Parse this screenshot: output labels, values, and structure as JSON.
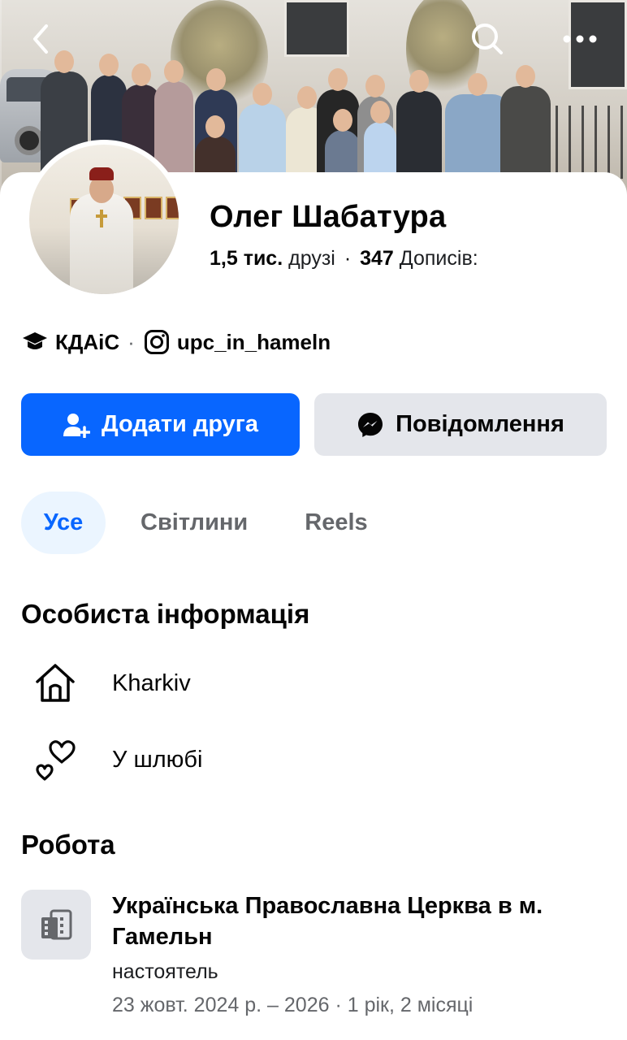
{
  "header": {
    "back_icon": "chevron-left-icon",
    "search_icon": "search-icon",
    "more_icon": "more-horizontal-icon"
  },
  "profile": {
    "name": "Олег Шабатура",
    "friends_count": "1,5 тис.",
    "friends_label": "друзі",
    "separator": "·",
    "posts_count": "347",
    "posts_label": "Дописів:"
  },
  "meta": {
    "education": "КДАіС",
    "instagram": "upc_in_hameln",
    "dot": "·"
  },
  "actions": {
    "add_friend_label": "Додати друга",
    "message_label": "Повідомлення"
  },
  "tabs": [
    {
      "label": "Усе",
      "active": true
    },
    {
      "label": "Світлини",
      "active": false
    },
    {
      "label": "Reels",
      "active": false
    }
  ],
  "personal_info": {
    "title": "Особиста інформація",
    "city": "Kharkiv",
    "relationship": "У шлюбі"
  },
  "work": {
    "title": "Робота",
    "employer": "Українська Православна Церква в м. Гамельн",
    "position": "настоятель",
    "dates": "23 жовт. 2024 р. – 2026 · 1 рік, 2 місяці"
  },
  "colors": {
    "primary": "#0866ff",
    "secondary_button": "#e4e6eb",
    "active_tab_bg": "#ebf5ff",
    "muted_text": "#65676b"
  }
}
